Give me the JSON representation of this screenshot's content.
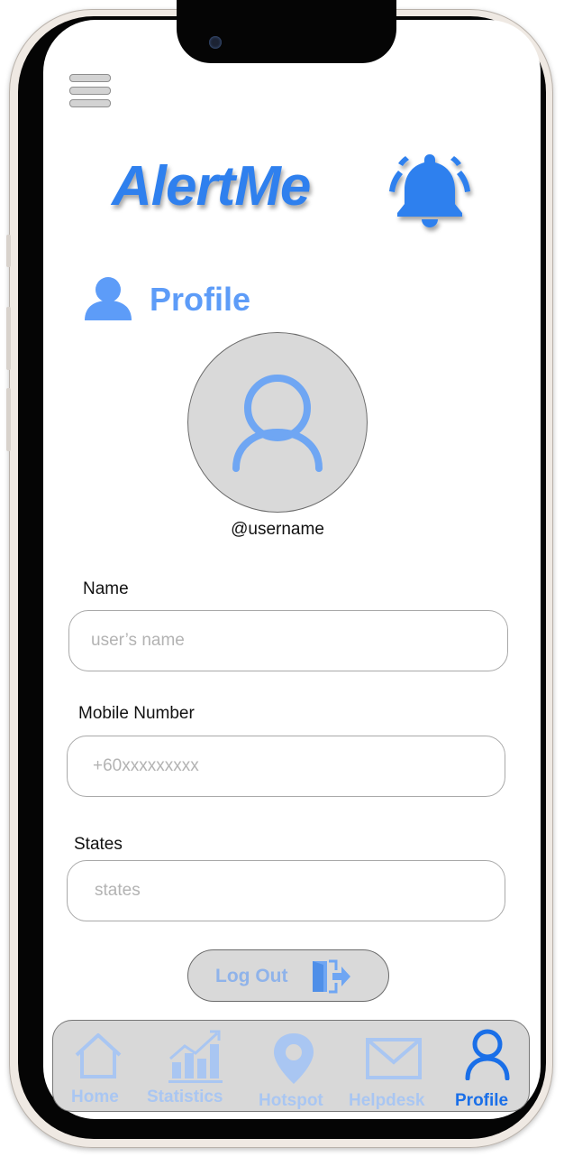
{
  "app": {
    "logo_text": "AlertMe"
  },
  "header": {
    "title": "Profile",
    "icon": "user-icon"
  },
  "profile": {
    "username": "@username",
    "avatar_icon": "user-outline-icon"
  },
  "form": {
    "name": {
      "label": "Name",
      "placeholder": "user’s name",
      "value": ""
    },
    "mobile": {
      "label": "Mobile Number",
      "placeholder": "+60xxxxxxxxx",
      "value": ""
    },
    "states": {
      "label": "States",
      "placeholder": "states",
      "value": ""
    }
  },
  "logout": {
    "label": "Log Out",
    "icon": "door-exit-icon"
  },
  "nav": {
    "items": [
      {
        "label": "Home",
        "icon": "home-icon"
      },
      {
        "label": "Statistics",
        "icon": "chart-icon"
      },
      {
        "label": "Hotspot",
        "icon": "map-pin-icon"
      },
      {
        "label": "Helpdesk",
        "icon": "mail-icon"
      },
      {
        "label": "Profile",
        "icon": "user-outline-icon"
      }
    ],
    "active": "Profile"
  },
  "colors": {
    "brand": "#2f80ee",
    "accent_light": "#5d9cf8",
    "nav_inactive": "#a9c6f2",
    "nav_active": "#1a6fe8"
  }
}
